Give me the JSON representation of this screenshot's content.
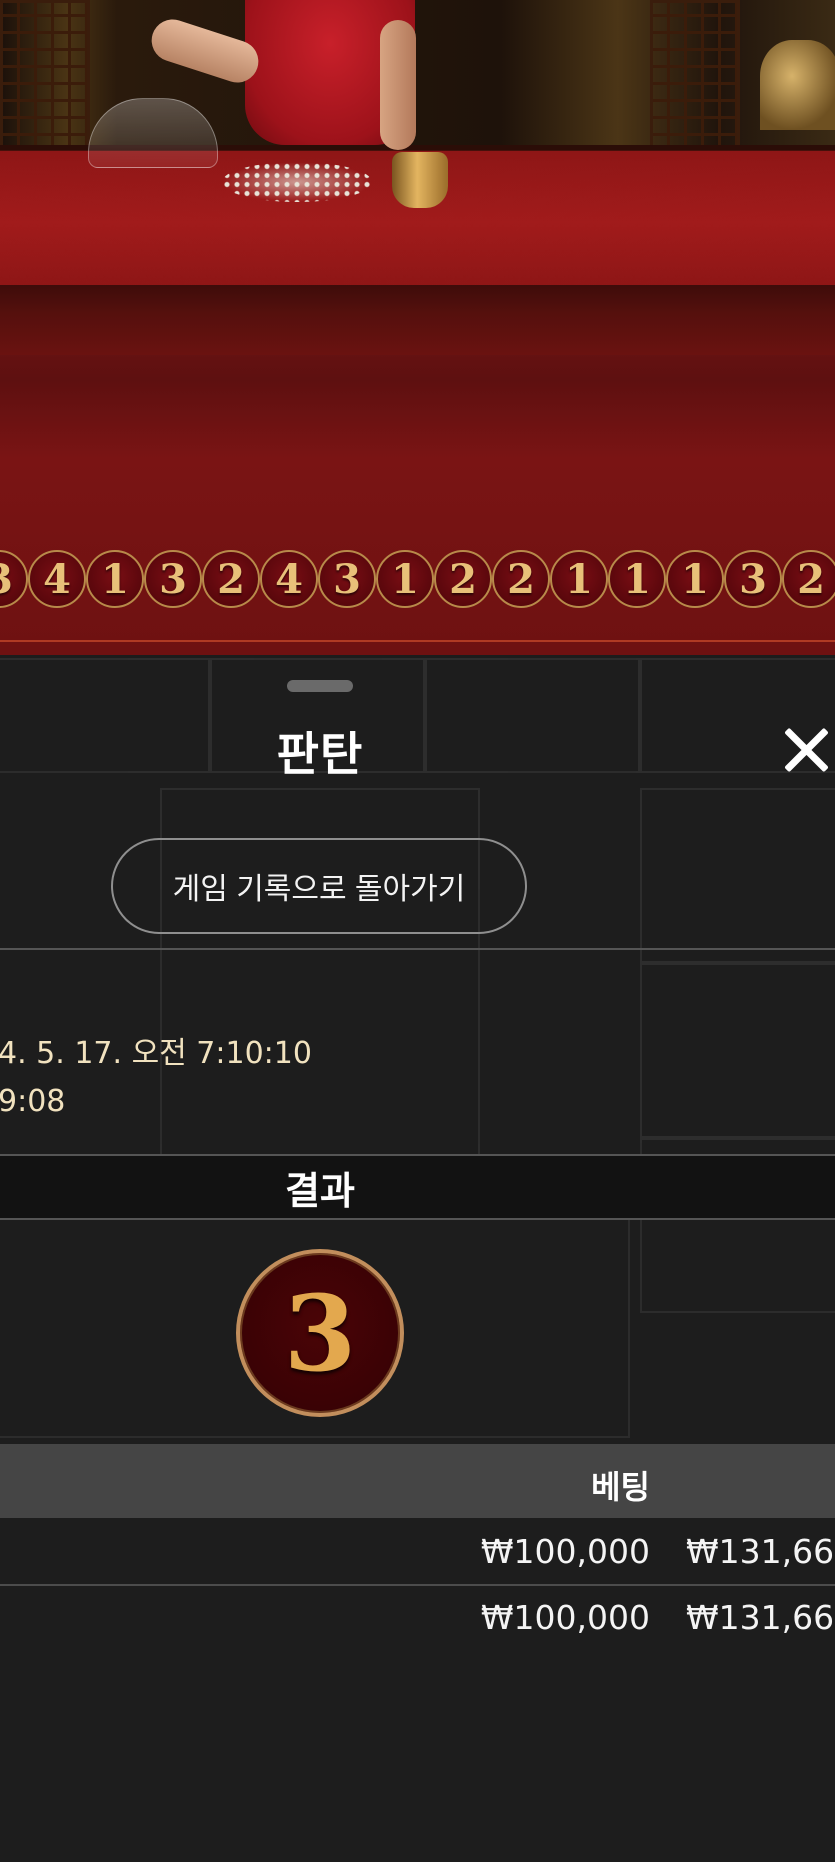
{
  "history_road": {
    "results": [
      "3",
      "4",
      "1",
      "3",
      "2",
      "4",
      "3",
      "1",
      "2",
      "2",
      "1",
      "1",
      "1",
      "3",
      "2"
    ]
  },
  "sheet": {
    "title": "판탄",
    "close_icon": "close-icon",
    "back_button_label": "게임 기록으로 돌아가기",
    "round_datetime": "4. 5. 17. 오전 7:10:10",
    "round_duration": "9:08",
    "result_label": "결과",
    "result_value": "3",
    "bets_table": {
      "columns": [
        "베팅"
      ],
      "rows": [
        {
          "bet": "₩100,000",
          "payout": "₩131,66"
        },
        {
          "bet": "₩100,000",
          "payout": "₩131,66"
        }
      ]
    }
  },
  "colors": {
    "sheet_bg": "#1d1d1d",
    "result_ball_border": "#c28e5c",
    "result_digit": "#e3a84e",
    "meta_text": "#f1e2bf"
  }
}
